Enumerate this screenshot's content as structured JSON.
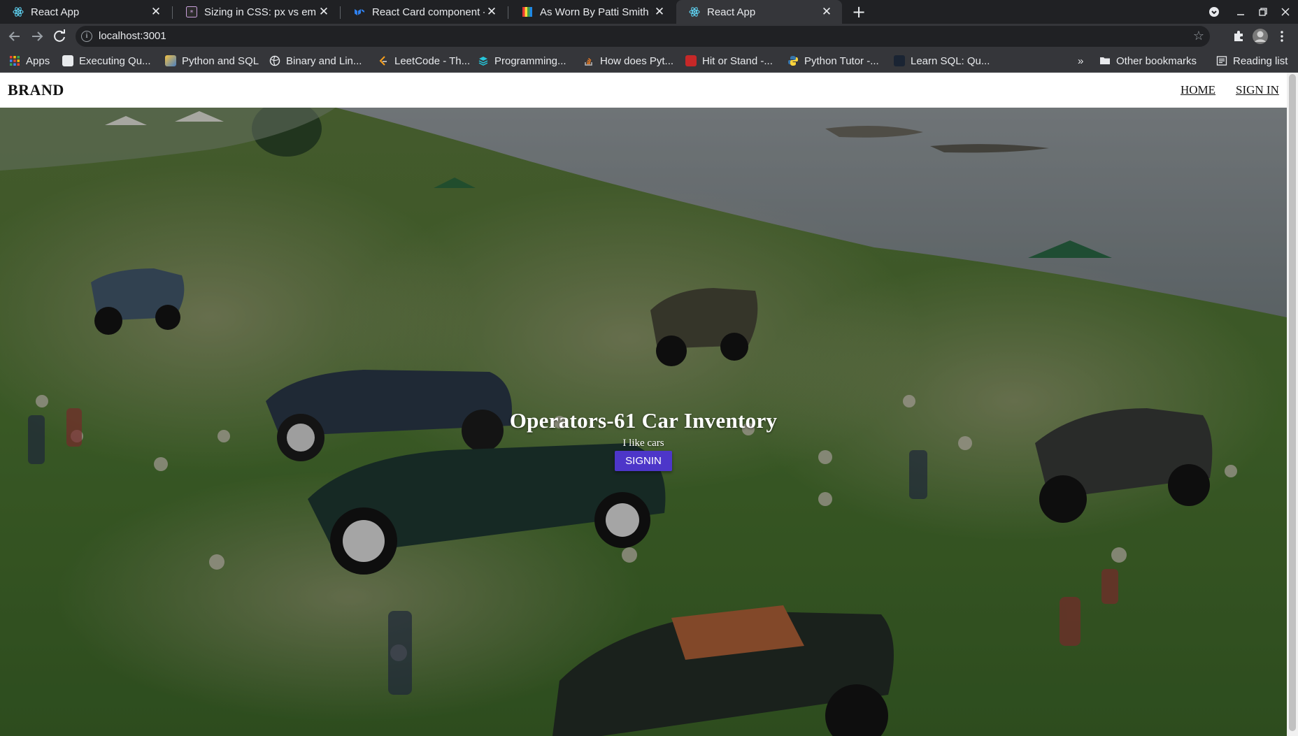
{
  "browser": {
    "tabs": [
      {
        "title": "React App",
        "icon": "react-icon",
        "active": false
      },
      {
        "title": "Sizing in CSS: px vs em vs",
        "icon": "css-tricks-icon",
        "active": false
      },
      {
        "title": "React Card component - M",
        "icon": "mui-icon",
        "active": false
      },
      {
        "title": "As Worn By Patti Smith Ke",
        "icon": "striped-icon",
        "active": false
      },
      {
        "title": "React App",
        "icon": "react-icon",
        "active": true
      }
    ],
    "address": "localhost:3001",
    "bookmarks": [
      {
        "label": "Apps",
        "icon": "apps-grid-icon"
      },
      {
        "label": "Executing Qu...",
        "icon": "page-icon"
      },
      {
        "label": "Python and SQL",
        "icon": "image-icon"
      },
      {
        "label": "Binary and Lin...",
        "icon": "globe-icon"
      },
      {
        "label": "LeetCode - Th...",
        "icon": "leetcode-icon"
      },
      {
        "label": "Programming...",
        "icon": "stack-icon"
      },
      {
        "label": "How does Pyt...",
        "icon": "stackoverflow-icon"
      },
      {
        "label": "Hit or Stand -...",
        "icon": "red-square-icon"
      },
      {
        "label": "Python Tutor -...",
        "icon": "python-icon"
      },
      {
        "label": "Learn SQL: Qu...",
        "icon": "dark-square-icon"
      }
    ],
    "overflow": "»",
    "other_bookmarks": "Other bookmarks",
    "reading_list": "Reading list"
  },
  "page": {
    "navbar": {
      "brand": "BRAND",
      "links": [
        "HOME",
        "SIGN IN"
      ]
    },
    "hero": {
      "title": "Operators-61 Car Inventory",
      "subtitle": "I like cars",
      "button": "SIGNIN"
    }
  },
  "colors": {
    "button": "#4d36c9",
    "browser_dark": "#202124",
    "toolbar": "#35363a"
  }
}
